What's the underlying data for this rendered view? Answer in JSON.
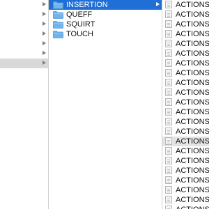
{
  "column2": {
    "items": [
      {
        "name": "INSERTION",
        "selected": true
      },
      {
        "name": "QUEFF",
        "selected": false
      },
      {
        "name": "SQUIRT",
        "selected": false
      },
      {
        "name": "TOUCH",
        "selected": false
      }
    ]
  },
  "column3": {
    "items": [
      "ACTIONS_V",
      "ACTIONS_V",
      "ACTIONS_V",
      "ACTIONS_V",
      "ACTIONS_V",
      "ACTIONS_V",
      "ACTIONS_V",
      "ACTIONS_V",
      "ACTIONS_V",
      "ACTIONS_V",
      "ACTIONS_V",
      "ACTIONS_V",
      "ACTIONS_V",
      "ACTIONS_V",
      "ACTIONS_V",
      "ACTIONS_V",
      "ACTIONS_V",
      "ACTIONS_V",
      "ACTIONS_V",
      "ACTIONS_V",
      "ACTIONS_V",
      "ACTIONS_V"
    ],
    "selected_index": 14
  },
  "colors": {
    "selection_blue": "#1f6fd6",
    "selection_gray": "#d9d9d9",
    "folder_blue": "#6fb5ec"
  },
  "icons": {
    "folder": "folder-icon",
    "document": "document-icon",
    "disclosure": "chevron-right-icon"
  }
}
